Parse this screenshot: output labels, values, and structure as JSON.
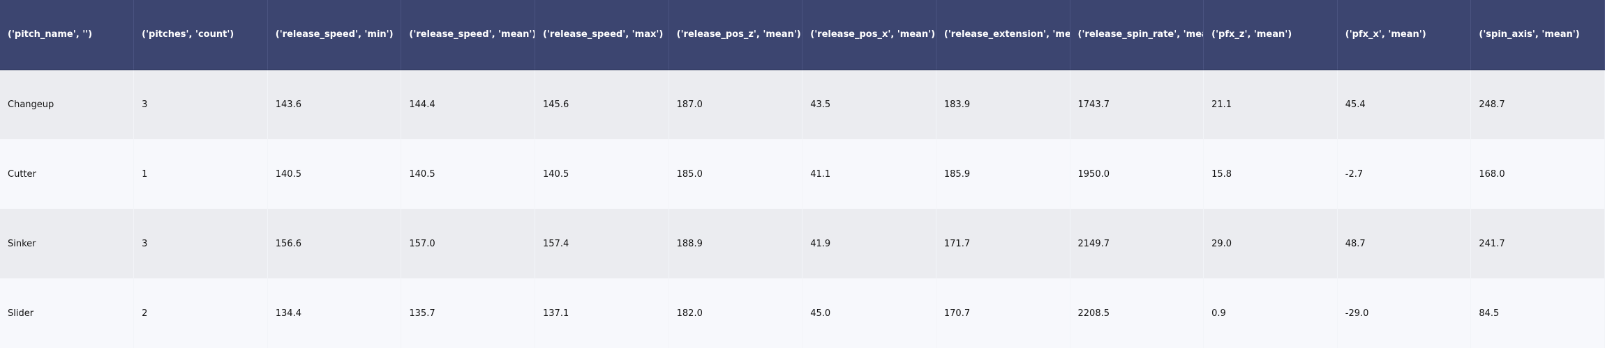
{
  "colors": {
    "header_bg": "#3c4570",
    "header_text": "#ffffff",
    "row_odd_bg": "#ebecf0",
    "row_even_bg": "#f7f8fc"
  },
  "table": {
    "columns": [
      "('pitch_name', '')",
      "('pitches', 'count')",
      "('release_speed', 'min')",
      "('release_speed', 'mean')",
      "('release_speed', 'max')",
      "('release_pos_z', 'mean')",
      "('release_pos_x', 'mean')",
      "('release_extension', 'mean')",
      "('release_spin_rate', 'mean')",
      "('pfx_z', 'mean')",
      "('pfx_x', 'mean')",
      "('spin_axis', 'mean')"
    ],
    "rows": [
      [
        "Changeup",
        "3",
        "143.6",
        "144.4",
        "145.6",
        "187.0",
        "43.5",
        "183.9",
        "1743.7",
        "21.1",
        "45.4",
        "248.7"
      ],
      [
        "Cutter",
        "1",
        "140.5",
        "140.5",
        "140.5",
        "185.0",
        "41.1",
        "185.9",
        "1950.0",
        "15.8",
        "-2.7",
        "168.0"
      ],
      [
        "Sinker",
        "3",
        "156.6",
        "157.0",
        "157.4",
        "188.9",
        "41.9",
        "171.7",
        "2149.7",
        "29.0",
        "48.7",
        "241.7"
      ],
      [
        "Slider",
        "2",
        "134.4",
        "135.7",
        "137.1",
        "182.0",
        "45.0",
        "170.7",
        "2208.5",
        "0.9",
        "-29.0",
        "84.5"
      ]
    ]
  }
}
